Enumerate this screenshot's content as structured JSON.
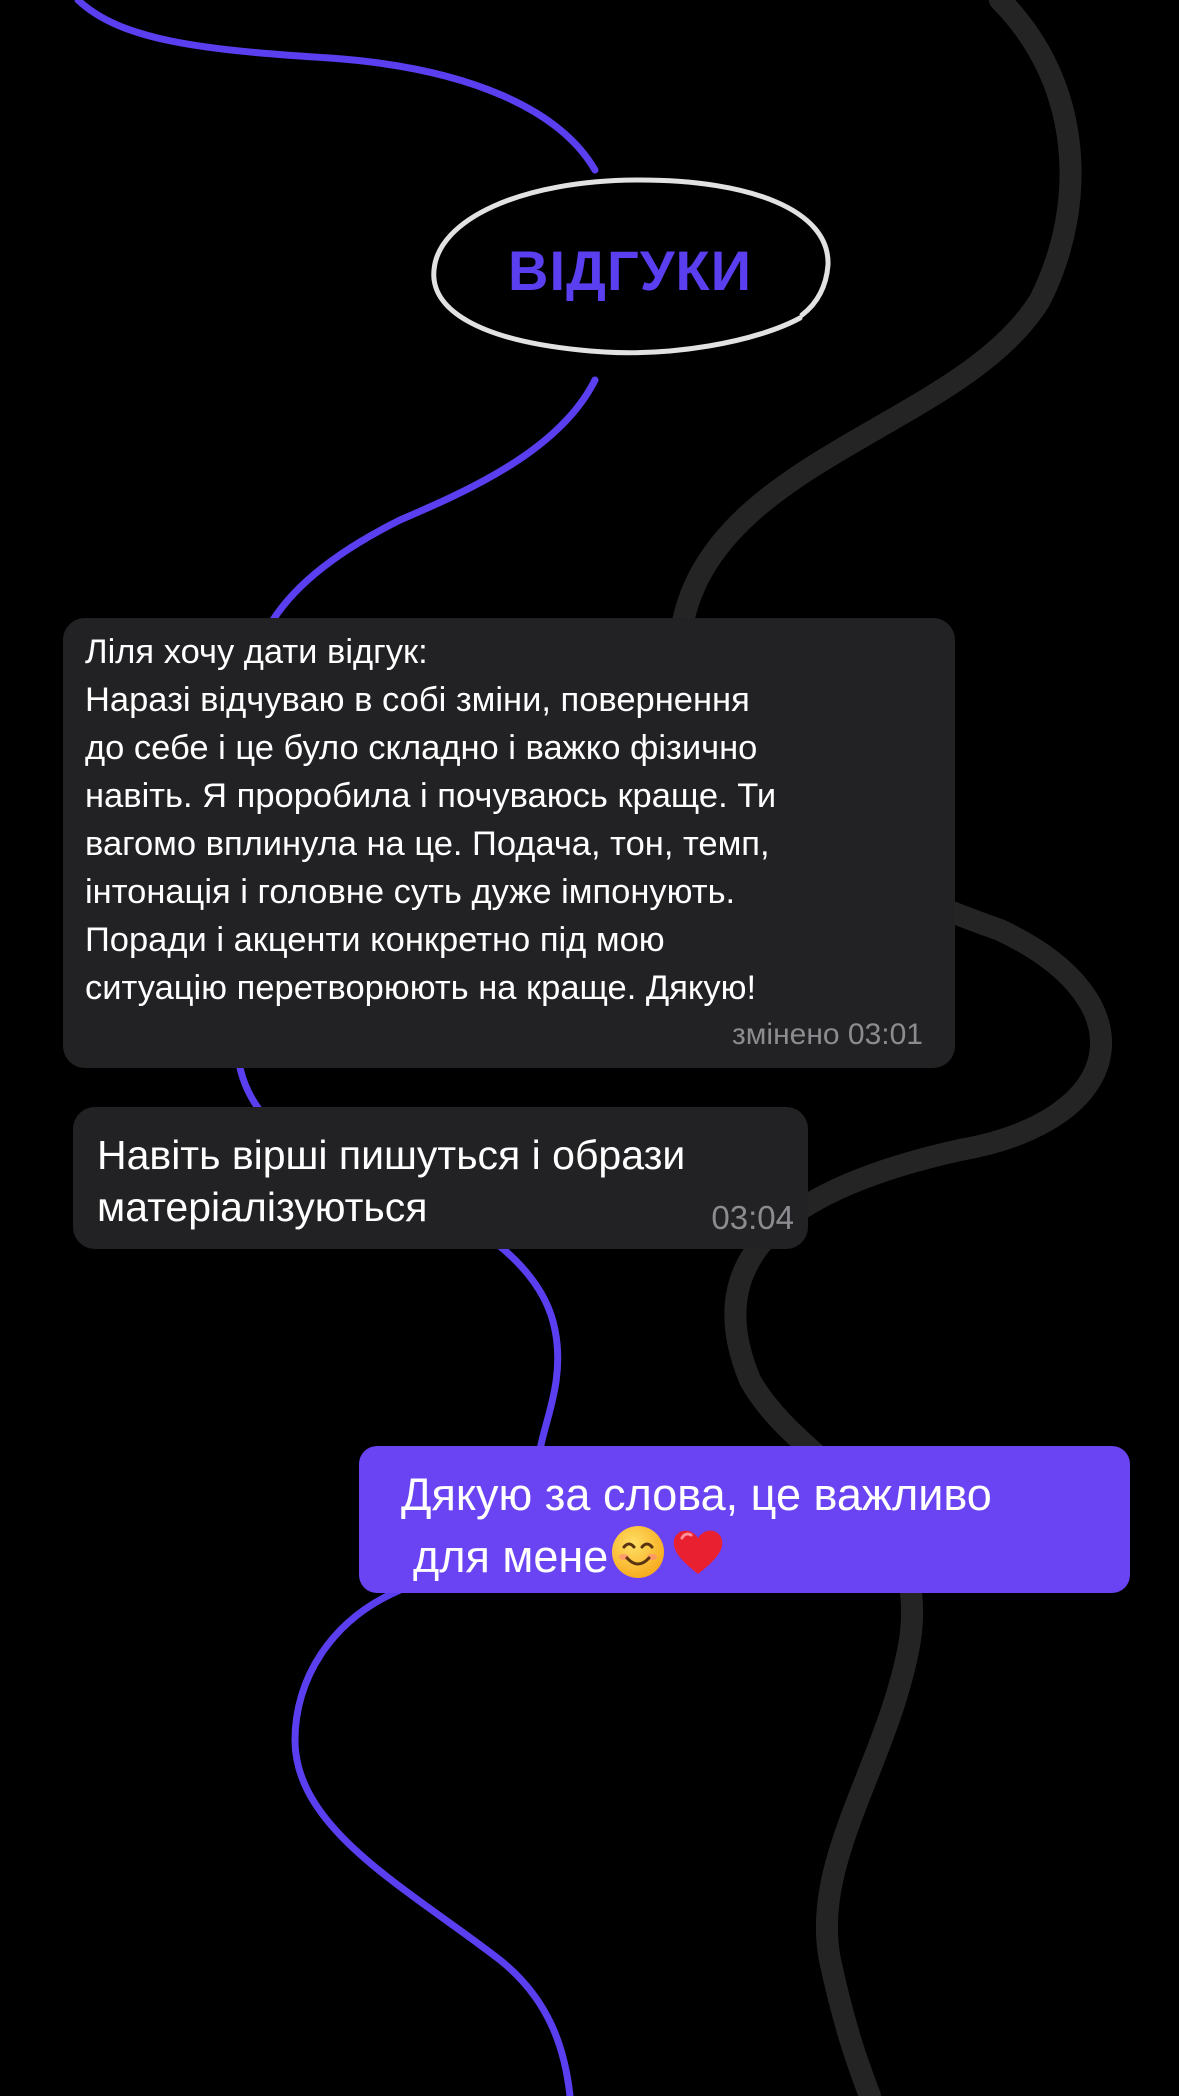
{
  "header": {
    "title": "ВІДГУКИ"
  },
  "messages": [
    {
      "text": "Ліля хочу дати відгук:\nНаразі відчуваю в собі зміни, повернення\nдо себе і це було складно і важко фізично\nнавіть. Я проробила і почуваюсь краще. Ти\nвагомо вплинула на це. Подача, тон, темп,\nінтонація і головне суть дуже імпонують.\nПоради і акценти конкретно під мою\nситуацію перетворюють на краще. Дякую!",
      "meta": "змінено 03:01"
    },
    {
      "text": "Навіть вірші пишуться і образи\nматеріалізуються",
      "meta": "03:04"
    },
    {
      "line1": "Дякую за слова, це важливо",
      "line2": "для мене",
      "emojis": [
        "smiling-face-icon",
        "red-heart-icon"
      ]
    }
  ],
  "colors": {
    "background": "#000000",
    "accent": "#5a3ff0",
    "incoming_bubble": "#222224",
    "outgoing_bubble": "#6a44f3",
    "meta_text": "#8c8c90",
    "decorative_line_dark": "#242424"
  }
}
